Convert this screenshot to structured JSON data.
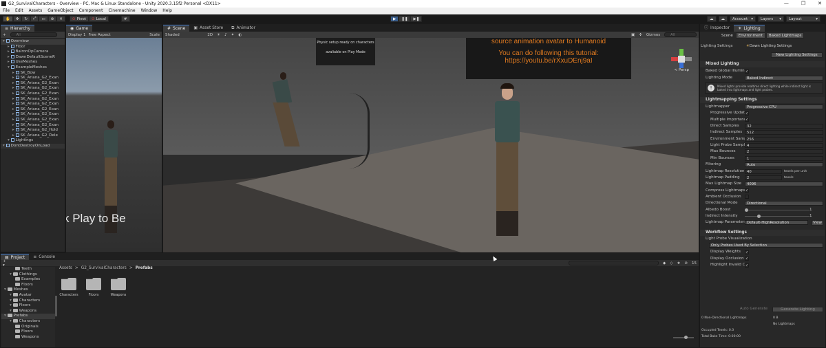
{
  "window": {
    "title": "G2_SurvivalCharacters - Overview - PC, Mac & Linux Standalone - Unity 2020.3.15f2 Personal <DX11>",
    "controls": [
      "—",
      "❐",
      "✕"
    ]
  },
  "menu": [
    "File",
    "Edit",
    "Assets",
    "GameObject",
    "Component",
    "Cinemachine",
    "Window",
    "Help"
  ],
  "toolbar": {
    "pivot": "Pivot",
    "local": "Local",
    "account": "Account",
    "layers": "Layers",
    "layout": "Layout"
  },
  "hierarchy": {
    "tab": "Hierarchy",
    "add": "+",
    "search_placeholder": "All",
    "items": [
      {
        "label": "Overview",
        "indent": 0,
        "kind": "scene",
        "selected": true
      },
      {
        "label": "Floor",
        "indent": 1,
        "kind": "cube"
      },
      {
        "label": "BalronOpCamera",
        "indent": 1,
        "kind": "cube"
      },
      {
        "label": "DawnDefaultSceneR",
        "indent": 1,
        "kind": "cube"
      },
      {
        "label": "UseMeshes",
        "indent": 1,
        "kind": "cube"
      },
      {
        "label": "ExampleMeshes",
        "indent": 1,
        "kind": "cube"
      },
      {
        "label": "SK_Bow",
        "indent": 2,
        "kind": "cube"
      },
      {
        "label": "SK_Ariana_G2_Exan",
        "indent": 2,
        "kind": "cube"
      },
      {
        "label": "SK_Ariana_G2_Exan",
        "indent": 2,
        "kind": "cube"
      },
      {
        "label": "SK_Ariana_G2_Exan",
        "indent": 2,
        "kind": "cube"
      },
      {
        "label": "SK_Ariana_G2_Exan",
        "indent": 2,
        "kind": "cube"
      },
      {
        "label": "SK_Ariana_G2_Exan",
        "indent": 2,
        "kind": "cube"
      },
      {
        "label": "SK_Ariana_G2_Exan",
        "indent": 2,
        "kind": "cube"
      },
      {
        "label": "SK_Ariana_G2_Exan",
        "indent": 2,
        "kind": "cube"
      },
      {
        "label": "SK_Ariana_G2_Exan",
        "indent": 2,
        "kind": "cube"
      },
      {
        "label": "SK_Ariana_G2_Exan",
        "indent": 2,
        "kind": "cube"
      },
      {
        "label": "SK_Ariana_G2_Exan",
        "indent": 2,
        "kind": "cube"
      },
      {
        "label": "SK_Ariana_G2_Hold",
        "indent": 2,
        "kind": "cube"
      },
      {
        "label": "SK_Ariana_G2_Dele",
        "indent": 2,
        "kind": "cube"
      },
      {
        "label": "Lightings",
        "indent": 1,
        "kind": "cube"
      },
      {
        "label": "DontDestroyOnLoad",
        "indent": 0,
        "kind": "scene"
      }
    ]
  },
  "game": {
    "tab": "Game",
    "display": "Display 1",
    "aspect": "Free Aspect",
    "scale": "Scale",
    "overlay": "k Play to Be"
  },
  "scene": {
    "tabs": [
      "Scene",
      "Asset Store",
      "Animator"
    ],
    "shading": "Shaded",
    "mode2d": "2D",
    "gizmos": "Gizmos",
    "search": "All",
    "poster_lines": [
      "source animation avatar to Humanoid",
      "You can do following this tutorial:",
      "https://youtu.be/rXxuDEnj9aI"
    ],
    "small_sign": [
      "Physic setup ready on characters",
      "avaliable on Play Mode"
    ],
    "persp": "< Persp"
  },
  "inspector": {
    "tabs": [
      "Inspector",
      "Lighting"
    ],
    "subtabs": [
      "Scene",
      "Environment",
      "Baked Lightmaps"
    ],
    "lighting_settings_label": "Lighting Settings",
    "lighting_settings_value": "Dawn Lighting Settings",
    "new_btn": "New Lighting Settings",
    "mixed": {
      "header": "Mixed Lighting",
      "baked_gi": "Baked Global Illumina",
      "mode_label": "Lighting Mode",
      "mode_value": "Baked Indirect",
      "info": "Mixed lights provide realtime direct lighting while indirect light is baked into lightmaps and light probes."
    },
    "lm": {
      "header": "Lightmapping Settings",
      "rows": [
        {
          "label": "Lightmapper",
          "value": "Progressive CPU",
          "type": "dd"
        },
        {
          "label": "Progressive Updat",
          "value": "✓",
          "type": "chk"
        },
        {
          "label": "Multiple Importanc",
          "value": "✓",
          "type": "chk"
        },
        {
          "label": "Direct Samples",
          "value": "32",
          "type": "val"
        },
        {
          "label": "Indirect Samples",
          "value": "512",
          "type": "val"
        },
        {
          "label": "Environment Samp",
          "value": "256",
          "type": "val"
        },
        {
          "label": "Light Probe Sampl",
          "value": "4",
          "type": "val"
        },
        {
          "label": "Max Bounces",
          "value": "2",
          "type": "val"
        },
        {
          "label": "Min Bounces",
          "value": "1",
          "type": "val"
        },
        {
          "label": "Filtering",
          "value": "Auto",
          "type": "dd"
        },
        {
          "label": "Lightmap Resolution",
          "value": "40",
          "type": "val",
          "suffix": "texels per unit"
        },
        {
          "label": "Lightmap Padding",
          "value": "2",
          "type": "val",
          "suffix": "texels"
        },
        {
          "label": "Max Lightmap Size",
          "value": "4096",
          "type": "dd"
        },
        {
          "label": "Compress Lightmaps",
          "value": "✓",
          "type": "chk"
        },
        {
          "label": "Ambient Occlusion",
          "value": "",
          "type": "chk"
        },
        {
          "label": "Directional Mode",
          "value": "Directional",
          "type": "dd"
        },
        {
          "label": "Albedo Boost",
          "value": "1",
          "type": "slider",
          "fraction": 0.0
        },
        {
          "label": "Indirect Intensity",
          "value": "1",
          "type": "slider",
          "fraction": 0.2
        },
        {
          "label": "Lightmap Parameters",
          "value": "Default-HighResolution",
          "type": "dd",
          "extra": "View"
        }
      ]
    },
    "wf": {
      "header": "Workflow Settings",
      "lpv": "Light Probe Visualization",
      "lpv_value": "Only Probes Used By Selection",
      "rows": [
        {
          "label": "Display Weights",
          "value": "✓"
        },
        {
          "label": "Display Occlusion",
          "value": "✓"
        },
        {
          "label": "Highlight Invalid C",
          "value": "✓"
        }
      ]
    },
    "auto_generate": "Auto Generate",
    "generate": "Generate Lighting",
    "stats": {
      "nondir": "0 Non-Directional Lightmaps",
      "nondir_val": "0 B",
      "no_lm": "No Lightmaps",
      "occupied": "Occupied Texels: 0.0",
      "bake_time": "Total Bake Time: 0:00:00"
    }
  },
  "project": {
    "tabs": [
      "Project",
      "Console"
    ],
    "tree": [
      {
        "label": "Teeth",
        "indent": 2
      },
      {
        "label": "Clothings",
        "indent": 1
      },
      {
        "label": "Examples",
        "indent": 2
      },
      {
        "label": "Floors",
        "indent": 2
      },
      {
        "label": "Meshes",
        "indent": 0
      },
      {
        "label": "Avatar",
        "indent": 1
      },
      {
        "label": "Characters",
        "indent": 1
      },
      {
        "label": "Floors",
        "indent": 1
      },
      {
        "label": "Weapons",
        "indent": 1
      },
      {
        "label": "Prefabs",
        "indent": 0,
        "selected": true
      },
      {
        "label": "Characters",
        "indent": 1
      },
      {
        "label": "Originals",
        "indent": 2
      },
      {
        "label": "Floors",
        "indent": 2
      },
      {
        "label": "Weapons",
        "indent": 2
      }
    ],
    "breadcrumb": [
      "Assets",
      "G2_SurvivalCharacters",
      "Prefabs"
    ],
    "folders": [
      "Characters",
      "Floors",
      "Weapons"
    ],
    "count": "15"
  }
}
